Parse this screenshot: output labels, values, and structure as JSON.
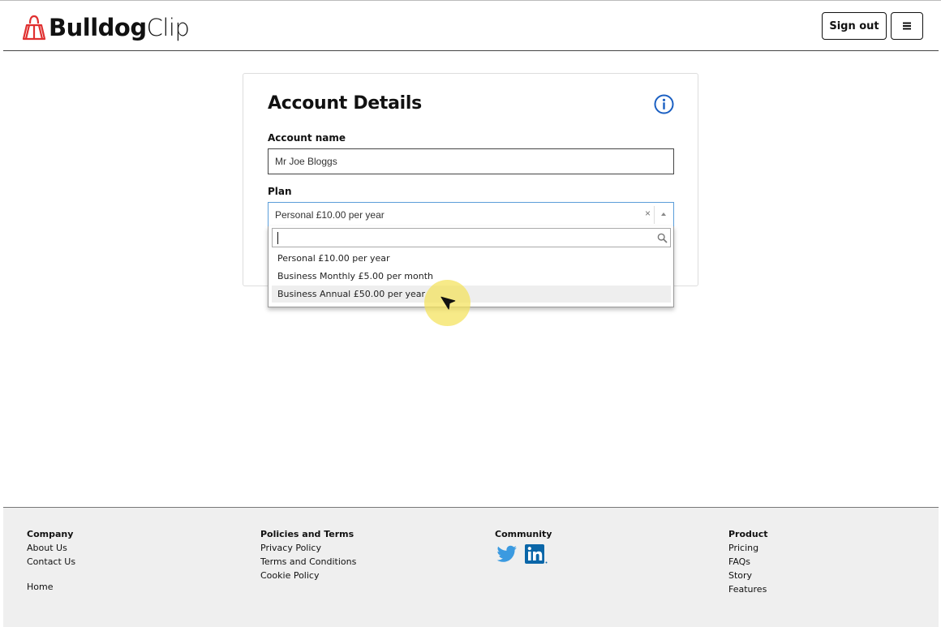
{
  "header": {
    "logo_bold": "Bulldog",
    "logo_light": "Clip",
    "signout_label": "Sign out"
  },
  "card": {
    "title": "Account Details",
    "account_name_label": "Account name",
    "account_name_value": "Mr Joe Bloggs",
    "plan_label": "Plan",
    "plan_selected": "Personal £10.00 per year",
    "clear_symbol": "×"
  },
  "dropdown": {
    "search_value": "",
    "options": [
      {
        "label": "Personal £10.00 per year"
      },
      {
        "label": "Business Monthly £5.00 per month"
      },
      {
        "label": "Business Annual £50.00 per year"
      }
    ],
    "highlighted_index": 2
  },
  "footer": {
    "company": {
      "heading": "Company",
      "links": [
        "About Us",
        "Contact Us"
      ],
      "extra": "Home"
    },
    "policies": {
      "heading": "Policies and Terms",
      "links": [
        "Privacy Policy",
        "Terms and Conditions",
        "Cookie Policy"
      ]
    },
    "community": {
      "heading": "Community"
    },
    "product": {
      "heading": "Product",
      "links": [
        "Pricing",
        "FAQs",
        "Story",
        "Features"
      ]
    }
  },
  "colors": {
    "brand_red": "#e03030",
    "info_blue": "#1a5fc2",
    "focus_blue": "#5b9dd9",
    "twitter_blue": "#3b9ae0",
    "linkedin_blue": "#0a66a8",
    "cursor_highlight": "#f4e25a"
  },
  "icons": {
    "logo": "bulldog-clip-logo-icon",
    "menu": "hamburger-menu-icon",
    "info": "info-circle-icon",
    "clear": "clear-selection-icon",
    "arrow": "dropdown-arrow-up-icon",
    "search": "search-icon",
    "twitter": "twitter-icon",
    "linkedin": "linkedin-icon",
    "cursor": "mouse-pointer-icon"
  }
}
